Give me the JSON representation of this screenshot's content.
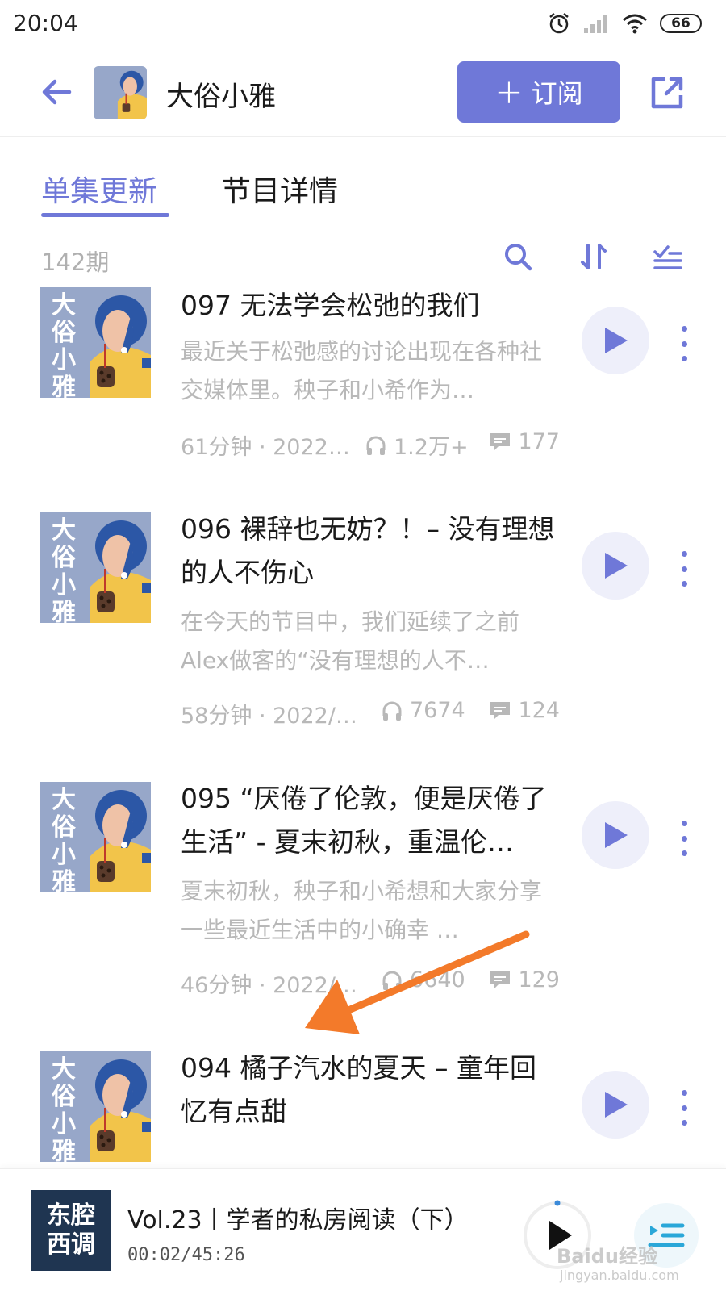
{
  "status_bar": {
    "time": "20:04",
    "battery": "66"
  },
  "header": {
    "title": "大俗小雅",
    "subscribe_label": "订阅"
  },
  "cover_text": [
    "大",
    "俗",
    "小",
    "雅"
  ],
  "tabs": [
    {
      "label": "单集更新"
    },
    {
      "label": "节目详情"
    }
  ],
  "toolbar": {
    "count": "142期"
  },
  "episodes": [
    {
      "title": "097 无法学会松弛的我们",
      "desc": "最近关于松弛感的讨论出现在各种社交媒体里。秧子和小希作为…",
      "duration_date": "61分钟 · 2022…",
      "plays": "1.2万+",
      "comments": "177"
    },
    {
      "title": "096 裸辞也无妨？！– 没有理想的人不伤心",
      "desc": "在今天的节目中，我们延续了之前Alex做客的“没有理想的人不…",
      "duration_date": "58分钟 · 2022/…",
      "plays": "7674",
      "comments": "124"
    },
    {
      "title": "095 “厌倦了伦敦，便是厌倦了生活” - 夏末初秋，重温伦…",
      "desc": "夏末初秋，秧子和小希想和大家分享一些最近生活中的小确幸 …",
      "duration_date": "46分钟 · 2022/…",
      "plays": "6640",
      "comments": "129"
    },
    {
      "title": "094 橘子汽水的夏天 – 童年回忆有点甜"
    }
  ],
  "player": {
    "cover_line1": "东腔",
    "cover_line2": "西调",
    "title": "Vol.23丨学者的私房阅读（下）",
    "time": "00:02/45:26",
    "progress": 0.0007
  },
  "watermark": {
    "main": "Baidu经验",
    "sub": "jingyan.baidu.com"
  },
  "colors": {
    "accent": "#6f78d8",
    "annotation_arrow": "#f37a2a",
    "muted_text": "#b8b8b8"
  }
}
